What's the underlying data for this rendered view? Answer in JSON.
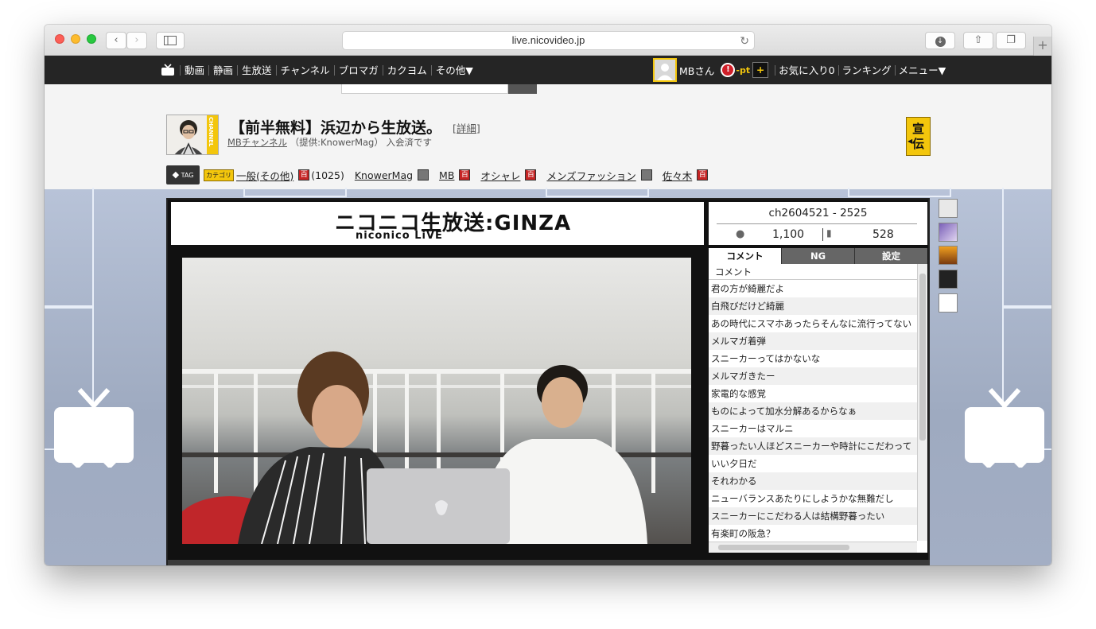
{
  "browser": {
    "url": "live.nicovideo.jp"
  },
  "nav": {
    "items": [
      "動画",
      "静画",
      "生放送",
      "チャンネル",
      "ブロマガ",
      "カクヨム",
      "その他▼"
    ],
    "user": "MBさん",
    "points": "-pt",
    "plus": "+",
    "links": [
      "お気に入り0",
      "ランキング",
      "メニュー▼"
    ]
  },
  "program": {
    "title": "【前半無料】浜辺から生放送。",
    "detail_link": "[詳細]",
    "channel_link": "MBチャンネル",
    "provider": "（提供:KnowerMag）",
    "member_status": "入会済です",
    "senden_label_1": "宣",
    "senden_label_2": "伝",
    "thumb_badge": "CHANNEL"
  },
  "tags": {
    "tag_icon_label": "TAG",
    "category_badge": "カテゴリ",
    "category": "一般(その他)",
    "category_count": "(1025)",
    "items": [
      "KnowerMag",
      "MB",
      "オシャレ",
      "メンズファッション",
      "佐々木"
    ],
    "dict_label": "百"
  },
  "player": {
    "banner_main": "ニコニコ生放送:GINZA",
    "banner_sub": "niconico LiVE",
    "channel_id": "ch2604521 - 2525",
    "viewers": "1,100",
    "comments_count": "528"
  },
  "panel": {
    "tabs": [
      "コメント",
      "NG",
      "設定"
    ],
    "list_header": "コメント",
    "comments": [
      "君の方が綺麗だよ",
      "白飛びだけど綺麗",
      "あの時代にスマホあったらそんなに流行ってない",
      "メルマガ着弾",
      "スニーカーってはかないな",
      "メルマガきたー",
      "家電的な感覚",
      "ものによって加水分解あるからなぁ",
      "スニーカーはマルニ",
      "野暮ったい人ほどスニーカーや時計にこだわって",
      "いい夕日だ",
      "それわかる",
      "ニューバランスあたりにしようかな無難だし",
      "スニーカーにこだわる人は結構野暮ったい",
      "有楽町の阪急？"
    ]
  },
  "colors": {
    "nav_bg": "#252525",
    "accent_yellow": "#f3c60c",
    "stage_blue": "#a7b2c8"
  }
}
